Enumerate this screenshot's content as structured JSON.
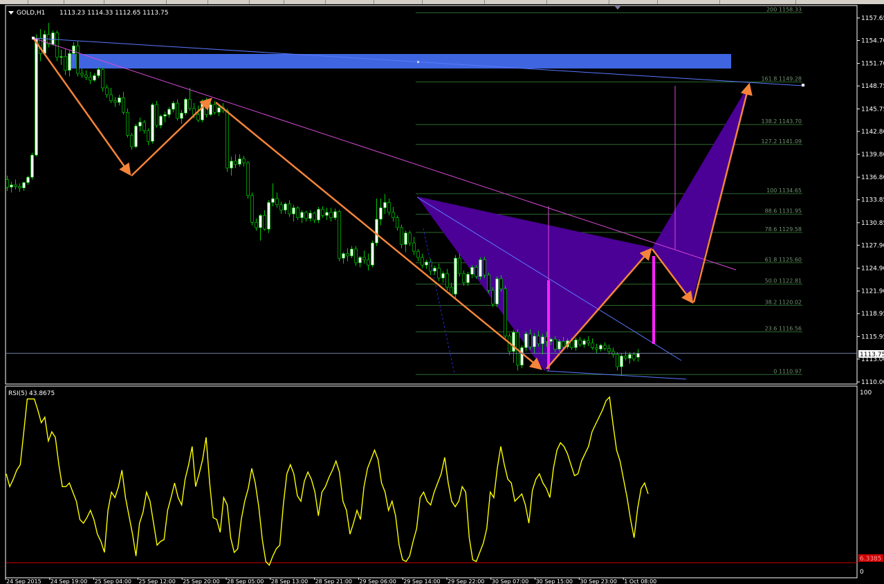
{
  "window": {
    "symbol_label": "GOLD,H1",
    "ohlc_values": "1113.23 1114.33 1112.65 1113.75"
  },
  "indicator": {
    "name": "RSI(5)",
    "value": "43.8675",
    "scale_top": "100",
    "scale_bottom": "0",
    "level_label": "6.3385"
  },
  "current_price_tag": "1113.75",
  "colors": {
    "background": "#000000",
    "axis": "#ffffff",
    "bull_candle": "#ffffff",
    "bear_candle": "#000000",
    "wick": "#00c800",
    "fib_lines": "#2e6b2e",
    "fib_labels": "#6f8f6f",
    "zigzag": "#f5843a",
    "harmonic_fill": "#4b0096",
    "trendline_magenta": "#d84ad8",
    "trendline_blue": "#5a78ff",
    "zone": "#3f66e0",
    "rsi_line": "#ffff00",
    "rsi_level": "#cc0000",
    "price_tag_bg": "#ffffff"
  },
  "chart_data": {
    "type": "candlestick",
    "title": "GOLD,H1",
    "y_axis": {
      "min": 1110.0,
      "max": 1158.9,
      "ticks": [
        "1157.65",
        "1154.70",
        "1151.70",
        "1148.75",
        "1145.75",
        "1142.80",
        "1139.80",
        "1136.80",
        "1133.85",
        "1130.85",
        "1127.90",
        "1124.90",
        "1121.90",
        "1118.95",
        "1115.95",
        "1113.00",
        "1110.00"
      ]
    },
    "x_axis": {
      "ticks": [
        "24 Sep 2015",
        "24 Sep 19:00",
        "25 Sep 04:00",
        "25 Sep 12:00",
        "25 Sep 20:00",
        "28 Sep 05:00",
        "28 Sep 13:00",
        "28 Sep 21:00",
        "29 Sep 06:00",
        "29 Sep 14:00",
        "29 Sep 22:00",
        "30 Sep 07:00",
        "30 Sep 15:00",
        "30 Sep 23:00",
        "1 Oct 08:00"
      ]
    },
    "candles": [
      [
        1136.5,
        1137.0,
        1135.0,
        1135.5
      ],
      [
        1135.5,
        1136.2,
        1134.8,
        1135.8
      ],
      [
        1135.8,
        1136.5,
        1135.2,
        1135.6
      ],
      [
        1135.6,
        1136.0,
        1134.9,
        1135.4
      ],
      [
        1135.4,
        1136.2,
        1135.0,
        1136.1
      ],
      [
        1136.1,
        1137.0,
        1135.8,
        1136.8
      ],
      [
        1136.8,
        1140.0,
        1136.5,
        1139.7
      ],
      [
        1139.7,
        1155.5,
        1139.5,
        1155.0
      ],
      [
        1155.0,
        1156.2,
        1152.0,
        1153.0
      ],
      [
        1153.0,
        1156.0,
        1152.8,
        1155.5
      ],
      [
        1155.5,
        1157.0,
        1153.8,
        1154.2
      ],
      [
        1154.2,
        1156.0,
        1154.0,
        1155.7
      ],
      [
        1155.7,
        1156.0,
        1152.0,
        1152.5
      ],
      [
        1152.5,
        1153.5,
        1151.5,
        1152.6
      ],
      [
        1152.6,
        1153.6,
        1150.2,
        1150.8
      ],
      [
        1150.8,
        1153.5,
        1150.0,
        1153.0
      ],
      [
        1153.0,
        1154.5,
        1152.2,
        1154.0
      ],
      [
        1154.0,
        1154.6,
        1150.0,
        1150.4
      ],
      [
        1150.4,
        1151.0,
        1149.8,
        1150.2
      ],
      [
        1150.2,
        1150.8,
        1149.5,
        1149.9
      ],
      [
        1149.9,
        1150.6,
        1149.0,
        1149.5
      ],
      [
        1149.5,
        1150.4,
        1149.3,
        1150.1
      ],
      [
        1150.1,
        1151.2,
        1149.8,
        1150.9
      ],
      [
        1150.9,
        1151.1,
        1148.0,
        1148.5
      ],
      [
        1148.5,
        1148.9,
        1147.2,
        1147.6
      ],
      [
        1147.6,
        1148.5,
        1146.5,
        1146.8
      ],
      [
        1146.8,
        1147.3,
        1146.0,
        1146.6
      ],
      [
        1146.6,
        1147.6,
        1146.2,
        1147.2
      ],
      [
        1147.2,
        1148.0,
        1145.0,
        1145.3
      ],
      [
        1145.3,
        1145.8,
        1142.0,
        1142.3
      ],
      [
        1142.3,
        1142.6,
        1140.4,
        1140.8
      ],
      [
        1140.8,
        1143.8,
        1140.6,
        1143.5
      ],
      [
        1143.5,
        1144.6,
        1142.8,
        1144.0
      ],
      [
        1144.0,
        1144.3,
        1142.5,
        1142.9
      ],
      [
        1142.9,
        1143.2,
        1141.0,
        1141.5
      ],
      [
        1141.5,
        1146.5,
        1141.2,
        1146.3
      ],
      [
        1146.3,
        1146.8,
        1143.3,
        1143.6
      ],
      [
        1143.6,
        1145.0,
        1143.2,
        1144.8
      ],
      [
        1144.8,
        1145.4,
        1144.0,
        1145.0
      ],
      [
        1145.0,
        1146.0,
        1144.6,
        1145.7
      ],
      [
        1145.7,
        1146.8,
        1145.3,
        1146.5
      ],
      [
        1146.5,
        1147.0,
        1144.2,
        1144.5
      ],
      [
        1144.5,
        1145.6,
        1143.8,
        1145.2
      ],
      [
        1145.2,
        1147.2,
        1144.9,
        1147.0
      ],
      [
        1147.0,
        1148.5,
        1145.5,
        1145.8
      ],
      [
        1145.8,
        1146.5,
        1144.5,
        1145.0
      ],
      [
        1145.0,
        1146.2,
        1144.0,
        1144.3
      ],
      [
        1144.3,
        1147.0,
        1144.0,
        1146.8
      ],
      [
        1146.8,
        1147.2,
        1144.6,
        1145.0
      ],
      [
        1145.0,
        1146.6,
        1144.8,
        1146.3
      ],
      [
        1146.3,
        1146.8,
        1145.0,
        1145.3
      ],
      [
        1145.3,
        1146.2,
        1144.8,
        1145.9
      ],
      [
        1145.9,
        1146.5,
        1145.2,
        1145.5
      ],
      [
        1145.5,
        1145.8,
        1137.5,
        1138.0
      ],
      [
        1138.0,
        1139.5,
        1137.0,
        1138.9
      ],
      [
        1138.9,
        1139.8,
        1138.0,
        1138.5
      ],
      [
        1138.5,
        1139.8,
        1138.2,
        1139.2
      ],
      [
        1139.2,
        1139.6,
        1138.2,
        1138.7
      ],
      [
        1138.7,
        1138.9,
        1134.0,
        1134.4
      ],
      [
        1134.4,
        1134.8,
        1130.5,
        1130.9
      ],
      [
        1130.9,
        1131.4,
        1129.8,
        1130.2
      ],
      [
        1130.2,
        1132.0,
        1128.5,
        1131.8
      ],
      [
        1131.8,
        1132.5,
        1129.8,
        1130.0
      ],
      [
        1130.0,
        1133.8,
        1129.5,
        1133.5
      ],
      [
        1133.5,
        1136.0,
        1133.0,
        1134.0
      ],
      [
        1134.0,
        1134.8,
        1132.8,
        1133.2
      ],
      [
        1133.2,
        1133.6,
        1132.0,
        1132.5
      ],
      [
        1132.5,
        1133.5,
        1132.0,
        1133.3
      ],
      [
        1133.3,
        1133.8,
        1131.6,
        1132.0
      ],
      [
        1132.0,
        1133.2,
        1131.0,
        1132.8
      ],
      [
        1132.8,
        1133.0,
        1131.2,
        1131.5
      ],
      [
        1131.5,
        1132.5,
        1130.8,
        1132.2
      ],
      [
        1132.2,
        1132.4,
        1131.0,
        1131.4
      ],
      [
        1131.4,
        1132.5,
        1131.0,
        1132.1
      ],
      [
        1132.1,
        1132.3,
        1130.8,
        1131.2
      ],
      [
        1131.2,
        1132.9,
        1130.8,
        1132.6
      ],
      [
        1132.6,
        1133.0,
        1131.5,
        1131.8
      ],
      [
        1131.8,
        1132.8,
        1131.2,
        1132.2
      ],
      [
        1132.2,
        1132.8,
        1131.0,
        1131.5
      ],
      [
        1131.5,
        1132.7,
        1131.2,
        1132.3
      ],
      [
        1132.3,
        1132.5,
        1125.8,
        1126.2
      ],
      [
        1126.2,
        1127.0,
        1125.5,
        1126.8
      ],
      [
        1126.8,
        1127.5,
        1125.8,
        1126.5
      ],
      [
        1126.5,
        1127.8,
        1126.2,
        1127.4
      ],
      [
        1127.4,
        1127.8,
        1125.2,
        1125.6
      ],
      [
        1125.6,
        1126.5,
        1125.0,
        1126.3
      ],
      [
        1126.3,
        1127.2,
        1125.5,
        1126.0
      ],
      [
        1126.0,
        1126.8,
        1124.6,
        1125.3
      ],
      [
        1125.3,
        1128.5,
        1125.0,
        1128.2
      ],
      [
        1128.2,
        1134.0,
        1127.8,
        1131.3
      ],
      [
        1131.3,
        1134.0,
        1130.5,
        1132.8
      ],
      [
        1132.8,
        1134.6,
        1132.0,
        1133.5
      ],
      [
        1133.5,
        1134.0,
        1131.8,
        1132.2
      ],
      [
        1132.2,
        1132.9,
        1131.0,
        1131.5
      ],
      [
        1131.5,
        1131.8,
        1129.8,
        1130.2
      ],
      [
        1130.2,
        1130.6,
        1127.5,
        1128.0
      ],
      [
        1128.0,
        1129.8,
        1127.0,
        1129.5
      ],
      [
        1129.5,
        1129.8,
        1127.8,
        1128.2
      ],
      [
        1128.2,
        1129.0,
        1126.6,
        1127.1
      ],
      [
        1127.1,
        1127.4,
        1125.8,
        1126.3
      ],
      [
        1126.3,
        1126.8,
        1124.9,
        1125.3
      ],
      [
        1125.3,
        1126.0,
        1124.8,
        1125.7
      ],
      [
        1125.7,
        1126.1,
        1124.0,
        1124.5
      ],
      [
        1124.5,
        1125.2,
        1124.0,
        1124.9
      ],
      [
        1124.9,
        1125.5,
        1123.2,
        1123.6
      ],
      [
        1123.6,
        1124.5,
        1123.0,
        1124.2
      ],
      [
        1124.2,
        1124.8,
        1122.0,
        1122.4
      ],
      [
        1122.4,
        1123.0,
        1121.2,
        1121.5
      ],
      [
        1121.5,
        1126.6,
        1121.0,
        1126.2
      ],
      [
        1126.2,
        1126.8,
        1123.8,
        1124.2
      ],
      [
        1124.2,
        1124.6,
        1122.6,
        1123.0
      ],
      [
        1123.0,
        1124.4,
        1122.6,
        1124.1
      ],
      [
        1124.1,
        1125.3,
        1123.6,
        1125.0
      ],
      [
        1125.0,
        1125.3,
        1123.5,
        1123.8
      ],
      [
        1123.8,
        1126.3,
        1123.4,
        1126.0
      ],
      [
        1126.0,
        1126.4,
        1123.6,
        1124.0
      ],
      [
        1124.0,
        1124.3,
        1121.6,
        1122.0
      ],
      [
        1122.0,
        1122.4,
        1119.8,
        1120.2
      ],
      [
        1120.2,
        1123.8,
        1119.8,
        1123.5
      ],
      [
        1123.5,
        1124.0,
        1121.8,
        1122.2
      ],
      [
        1122.2,
        1122.6,
        1115.5,
        1116.0
      ],
      [
        1116.0,
        1116.4,
        1113.5,
        1114.0
      ],
      [
        1114.0,
        1116.8,
        1112.5,
        1116.5
      ],
      [
        1116.5,
        1116.9,
        1111.5,
        1112.2
      ],
      [
        1112.2,
        1114.8,
        1111.8,
        1114.5
      ],
      [
        1114.5,
        1116.6,
        1114.0,
        1116.3
      ],
      [
        1116.3,
        1116.9,
        1114.2,
        1114.6
      ],
      [
        1114.6,
        1116.4,
        1113.8,
        1116.0
      ],
      [
        1116.0,
        1116.7,
        1114.6,
        1115.0
      ],
      [
        1115.0,
        1116.3,
        1113.6,
        1115.9
      ],
      [
        1115.9,
        1116.6,
        1114.6,
        1115.3
      ],
      [
        1115.3,
        1115.8,
        1114.8,
        1115.6
      ],
      [
        1115.6,
        1116.0,
        1113.9,
        1114.3
      ],
      [
        1114.3,
        1115.6,
        1114.0,
        1115.3
      ],
      [
        1115.3,
        1115.9,
        1114.2,
        1114.6
      ],
      [
        1114.6,
        1115.7,
        1114.3,
        1115.4
      ],
      [
        1115.4,
        1115.8,
        1114.2,
        1114.5
      ],
      [
        1114.5,
        1115.8,
        1114.1,
        1115.5
      ],
      [
        1115.5,
        1115.9,
        1114.6,
        1114.9
      ],
      [
        1114.9,
        1115.7,
        1114.5,
        1115.4
      ],
      [
        1115.4,
        1116.0,
        1114.7,
        1115.1
      ],
      [
        1115.1,
        1115.7,
        1114.2,
        1114.5
      ],
      [
        1114.5,
        1115.0,
        1113.8,
        1114.3
      ],
      [
        1114.3,
        1115.0,
        1114.0,
        1114.8
      ],
      [
        1114.8,
        1115.2,
        1114.1,
        1114.4
      ],
      [
        1114.4,
        1114.9,
        1113.6,
        1114.0
      ],
      [
        1114.0,
        1114.5,
        1113.2,
        1113.6
      ],
      [
        1113.6,
        1113.9,
        1111.5,
        1112.0
      ],
      [
        1112.0,
        1113.8,
        1110.8,
        1113.4
      ],
      [
        1113.4,
        1114.0,
        1112.8,
        1113.1
      ],
      [
        1113.1,
        1113.9,
        1112.4,
        1113.6
      ],
      [
        1113.6,
        1113.9,
        1112.7,
        1113.0
      ],
      [
        1113.23,
        1114.33,
        1112.65,
        1113.75
      ]
    ],
    "rsi": {
      "name": "RSI(5)",
      "last": 43.8675,
      "ylim": [
        0,
        100
      ],
      "level": 6.3385,
      "values": [
        55,
        48,
        52,
        57,
        60,
        78,
        96,
        96,
        96,
        90,
        83,
        86,
        73,
        78,
        75,
        60,
        48,
        48,
        50,
        45,
        40,
        30,
        28,
        31,
        35,
        30,
        22,
        18,
        12,
        35,
        45,
        42,
        48,
        57,
        42,
        32,
        22,
        10,
        28,
        34,
        45,
        40,
        28,
        16,
        18,
        19,
        35,
        42,
        50,
        42,
        38,
        52,
        60,
        70,
        48,
        55,
        63,
        75,
        50,
        31,
        30,
        23,
        42,
        38,
        20,
        12,
        14,
        30,
        40,
        47,
        58,
        50,
        37,
        19,
        7,
        5,
        10,
        14,
        16,
        38,
        55,
        60,
        55,
        43,
        40,
        51,
        56,
        52,
        45,
        32,
        45,
        48,
        53,
        57,
        62,
        56,
        40,
        35,
        22,
        28,
        35,
        30,
        48,
        58,
        63,
        68,
        63,
        50,
        45,
        35,
        40,
        32,
        16,
        8,
        7,
        10,
        18,
        25,
        42,
        45,
        40,
        38,
        45,
        50,
        55,
        64,
        50,
        40,
        37,
        40,
        48,
        45,
        20,
        8,
        7,
        12,
        17,
        25,
        45,
        42,
        58,
        70,
        60,
        52,
        50,
        40,
        42,
        44,
        38,
        28,
        46,
        52,
        55,
        50,
        47,
        42,
        58,
        68,
        72,
        70,
        66,
        60,
        54,
        55,
        62,
        66,
        70,
        78,
        82,
        86,
        90,
        95,
        97,
        82,
        68,
        62,
        52,
        42,
        30,
        20,
        36,
        47,
        50,
        44
      ]
    },
    "fibonacci": [
      {
        "level": "0",
        "price": 1110.97
      },
      {
        "level": "23.6",
        "price": 1116.56
      },
      {
        "level": "38.2",
        "price": 1120.02
      },
      {
        "level": "50.0",
        "price": 1122.81
      },
      {
        "level": "61.8",
        "price": 1125.6
      },
      {
        "level": "78.6",
        "price": 1129.58
      },
      {
        "level": "88.6",
        "price": 1131.95
      },
      {
        "level": "100",
        "price": 1134.65
      },
      {
        "level": "127.2",
        "price": 1141.09
      },
      {
        "level": "138.2",
        "price": 1143.7
      },
      {
        "level": "161.8",
        "price": 1149.28
      },
      {
        "level": "200",
        "price": 1158.33
      }
    ],
    "ylim": [
      1110.0,
      1158.9
    ]
  }
}
